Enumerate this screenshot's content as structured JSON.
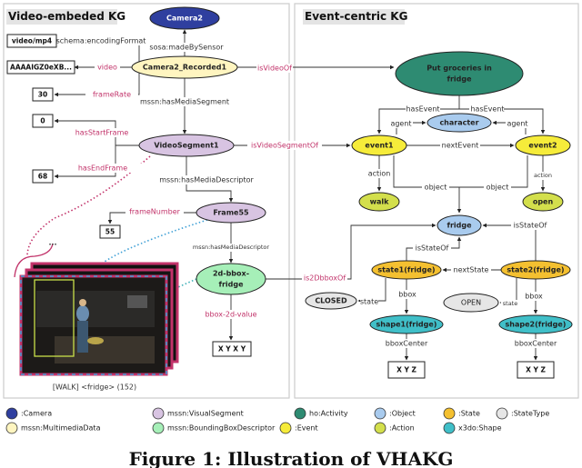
{
  "panels": {
    "left_title": "Video-embeded KG",
    "right_title": "Event-centric KG"
  },
  "colors": {
    "camera": "#2f3f9f",
    "multimedia": "#fff5c0",
    "visual_segment": "#d8c4e2",
    "bbox_descriptor": "#a6efb8",
    "activity": "#2e8b72",
    "object": "#a9cbee",
    "event": "#f6ec3a",
    "action": "#d3df4c",
    "state": "#f4c030",
    "state_type": "#e6e6e6",
    "shape": "#40bfc8",
    "property": "#c2336a"
  },
  "nodes": {
    "camera2": "Camera2",
    "camera2_recorded1": "Camera2_Recorded1",
    "video_segment1": "VideoSegment1",
    "frame55": "Frame55",
    "bbox_line1": "2d-bbox-",
    "bbox_line2": "fridge",
    "activity_line1": "Put groceries in",
    "activity_line2": "fridge",
    "character": "character",
    "event1": "event1",
    "event2": "event2",
    "walk": "walk",
    "open": "open",
    "fridge": "fridge",
    "state1": "state1(fridge)",
    "state2": "state2(fridge)",
    "closed": "CLOSED",
    "open_state": "OPEN",
    "shape1": "shape1(fridge)",
    "shape2": "shape2(fridge)"
  },
  "literals": {
    "mime": "video/mp4",
    "video": "AAAAIGZ0eXB...",
    "frame_rate": "30",
    "start": "0",
    "end": "68",
    "frame_number": "55",
    "bbox2d": "X Y X Y",
    "center1": "X Y Z",
    "center2": "X Y Z"
  },
  "edges": {
    "encoding": "schema:encodingFormat",
    "made_by": "sosa:madeBySensor",
    "video": "video",
    "frame_rate": "frameRate",
    "has_media_segment": "mssn:hasMediaSegment",
    "has_start": "hasStartFrame",
    "has_end": "hasEndFrame",
    "has_media_desc": "mssn:hasMediaDescriptor",
    "frame_number": "frameNumber",
    "has_media_desc2": "mssn:hasMediaDescriptor",
    "bbox_value": "bbox-2d-value",
    "is_video_of": "isVideoOf",
    "is_video_segment_of": "isVideoSegmentOf",
    "is_2dbbox_of": "is2DbboxOf",
    "has_event1": "hasEvent",
    "has_event2": "hasEvent",
    "agent1": "agent",
    "agent2": "agent",
    "next_event": "nextEvent",
    "action1": "action",
    "action2": "action",
    "object1": "object",
    "object2": "object",
    "is_state_of1": "isStateOf",
    "is_state_of2": "isStateOf",
    "next_state": "nextState",
    "state1": "state",
    "state2": "state",
    "bbox1": "bbox",
    "bbox2": "bbox",
    "center1": "bboxCenter",
    "center2": "bboxCenter"
  },
  "image_caption": "[WALK] <fridge> (152)",
  "image_dots": "...",
  "legend": [
    {
      "label": ":Camera",
      "color": "#2f3f9f"
    },
    {
      "label": "mssn:VisualSegment",
      "color": "#d8c4e2"
    },
    {
      "label": "ho:Activity",
      "color": "#2e8b72"
    },
    {
      "label": ":Object",
      "color": "#a9cbee"
    },
    {
      "label": ":State",
      "color": "#f4c030"
    },
    {
      "label": ":StateType",
      "color": "#e6e6e6"
    },
    {
      "label": "mssn:MultimediaData",
      "color": "#fff5c0"
    },
    {
      "label": "mssn:BoundingBoxDescriptor",
      "color": "#a6efb8"
    },
    {
      "label": ":Event",
      "color": "#f6ec3a"
    },
    {
      "label": ":Action",
      "color": "#d3df4c"
    },
    {
      "label": "x3do:Shape",
      "color": "#40bfc8"
    }
  ],
  "caption": "Figure 1: Illustration of VHAKG"
}
